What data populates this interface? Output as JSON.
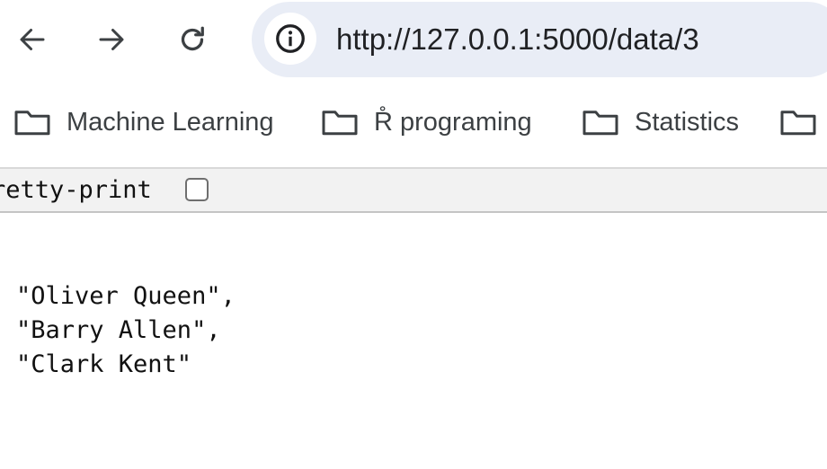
{
  "browser": {
    "nav": {
      "back_icon": "arrow-left-icon",
      "forward_icon": "arrow-right-icon",
      "reload_icon": "reload-icon"
    },
    "omnibox": {
      "site_info_icon": "info-icon",
      "url": "http://127.0.0.1:5000/data/3",
      "background": "#e9edf6"
    },
    "bookmarks": [
      {
        "label": "Machine Learning",
        "icon": "folder-icon"
      },
      {
        "label": "R̊ programing",
        "icon": "folder-icon"
      },
      {
        "label": "Statistics",
        "icon": "folder-icon"
      },
      {
        "label": "",
        "icon": "folder-icon"
      }
    ]
  },
  "viewer": {
    "pretty_print_label": "retty-print",
    "pretty_print_checked": false,
    "json_lines": [
      "\"Oliver Queen\",",
      "\"Barry Allen\",",
      "\"Clark Kent\""
    ]
  }
}
